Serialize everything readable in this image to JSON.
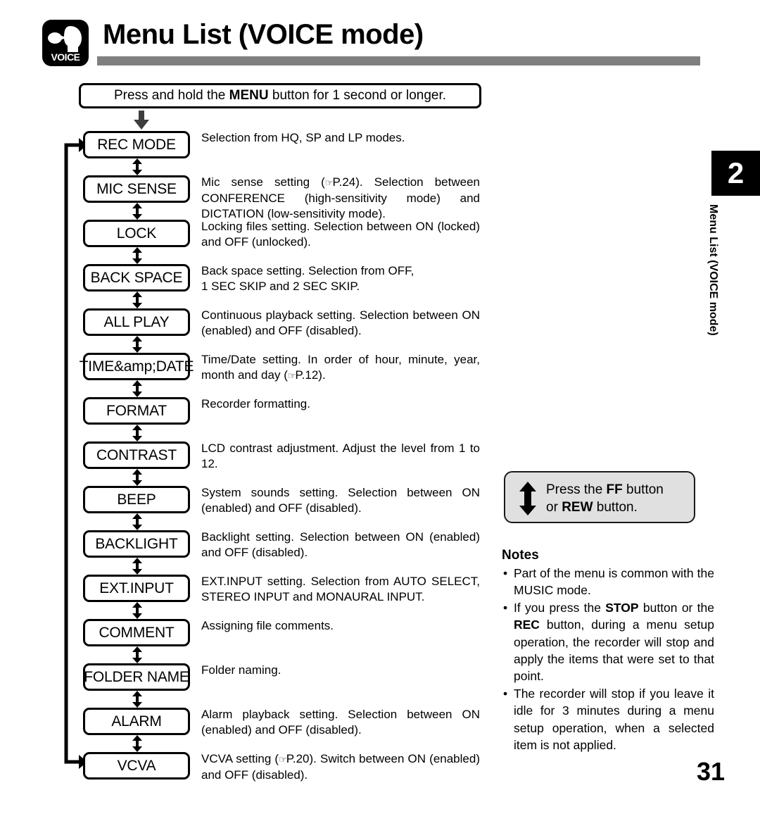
{
  "header": {
    "title": "Menu List  (VOICE mode)",
    "logo_label": "VOICE",
    "rule_color": "#7f7f7f"
  },
  "intro": {
    "prefix": "Press and hold the ",
    "emphasis": "MENU",
    "suffix": " button for 1 second or longer."
  },
  "flow": {
    "items": [
      {
        "label": "REC MODE",
        "desc_html": "Selection from  HQ, SP and LP modes."
      },
      {
        "label": "MIC SENSE",
        "desc_html": "Mic sense setting (<span class=\"hand\">&#9758;</span>P.24). Selection between CONFERENCE (high-sensitivity mode) and DICTATION (low-sensitivity mode)."
      },
      {
        "label": "LOCK",
        "desc_html": "Locking files setting. Selection between ON (locked) and OFF (unlocked)."
      },
      {
        "label": "BACK SPACE",
        "desc_html": "Back space setting. Selection from OFF,<br>1 SEC SKIP and 2 SEC SKIP."
      },
      {
        "label": "ALL PLAY",
        "desc_html": "Continuous playback setting. Selection between ON (enabled) and OFF (disabled)."
      },
      {
        "label": "TIME&amp;DATE",
        "desc_html": "Time/Date setting. In order of hour, minute, year, month and day (<span class=\"hand\">&#9758;</span>P.12)."
      },
      {
        "label": "FORMAT",
        "desc_html": "Recorder formatting."
      },
      {
        "label": "CONTRAST",
        "desc_html": "LCD contrast adjustment. Adjust the level from 1 to 12."
      },
      {
        "label": "BEEP",
        "desc_html": "System sounds setting. Selection between ON (enabled) and OFF (disabled)."
      },
      {
        "label": "BACKLIGHT",
        "desc_html": "Backlight setting. Selection between ON (enabled) and OFF (disabled)."
      },
      {
        "label": "EXT.INPUT",
        "desc_html": "EXT.INPUT setting. Selection from AUTO SELECT, STEREO INPUT and MONAURAL INPUT."
      },
      {
        "label": "COMMENT",
        "desc_html": "Assigning file comments."
      },
      {
        "label": "FOLDER NAME",
        "desc_html": "Folder naming."
      },
      {
        "label": "ALARM",
        "desc_html": "Alarm playback setting. Selection between ON (enabled) and OFF (disabled)."
      },
      {
        "label": "VCVA",
        "desc_html": "VCVA setting (<span class=\"hand\">&#9758;</span>P.20).  Switch between ON (enabled) and OFF (disabled)."
      }
    ]
  },
  "rail": {
    "chapter_number": "2",
    "chapter_label": "Menu List  (VOICE mode)"
  },
  "ffrew": {
    "line1_prefix": "Press the ",
    "line1_emphasis": "FF",
    "line1_suffix": " button",
    "line2_prefix": "or ",
    "line2_emphasis": "REW",
    "line2_suffix": " button.",
    "background": "#e0e0e0"
  },
  "notes": {
    "title": "Notes",
    "bullet": "•",
    "items": [
      {
        "html": "Part of the menu is common with the MUSIC mode."
      },
      {
        "html": "If you press the <b>STOP</b> button or the <b>REC</b> button, during a menu setup operation, the recorder will stop and apply the items that were set to that point."
      },
      {
        "html": "The recorder will stop if you leave it idle for 3 minutes during a menu setup operation, when a selected item is not applied."
      }
    ]
  },
  "page_number": "31"
}
